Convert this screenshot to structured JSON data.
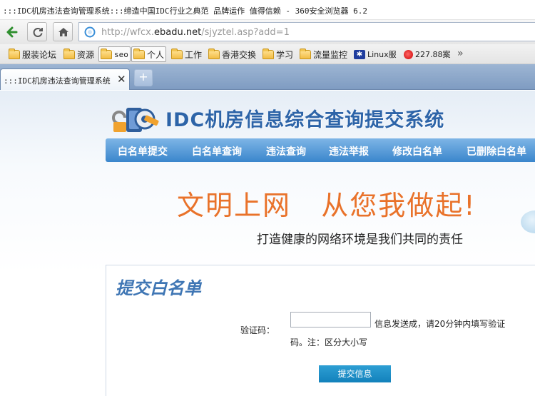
{
  "browser": {
    "window_title": ":::IDC机房违法查询管理系统:::缔造中国IDC行业之典范 品牌运作 值得信赖 - 360安全浏览器 6.2",
    "url_prefix": "http://wfcx.",
    "url_domain": "ebadu.net",
    "url_path": "/sjyztel.asp?add=1",
    "bookmarks": [
      {
        "label": "服装论坛",
        "icon": "folder-icon"
      },
      {
        "label": "资源",
        "icon": "folder-icon"
      },
      {
        "label": "seo",
        "icon": "folder-icon"
      },
      {
        "label": "个人",
        "icon": "folder-icon"
      },
      {
        "label": "工作",
        "icon": "folder-icon"
      },
      {
        "label": "香港交换",
        "icon": "folder-icon"
      },
      {
        "label": "学习",
        "icon": "folder-icon"
      },
      {
        "label": "流量监控",
        "icon": "folder-icon"
      },
      {
        "label": "Linux服",
        "icon": "paw-icon"
      },
      {
        "label": "227.88案",
        "icon": "red-circle-icon"
      }
    ],
    "more_bookmarks": "»",
    "tab": {
      "title": ":::IDC机房违法查询管理系统:",
      "close": "✕"
    },
    "new_tab": "+"
  },
  "site": {
    "title": "IDC机房信息综合查询提交系统",
    "menu": [
      "白名单提交",
      "白名单查询",
      "违法查询",
      "违法举报",
      "修改白名单",
      "已删除白名单"
    ],
    "slogan_1": "文明上网",
    "slogan_2": "从您我做起!",
    "slogan_sub": "打造健康的网络环境是我们共同的责任"
  },
  "form": {
    "title": "提交白名单",
    "captcha_label": "验证码：",
    "captcha_value": "",
    "hint_line1": "信息发送成，请20分钟内填写验证",
    "hint_line2": "码。注：区分大小写",
    "submit_label": "提交信息"
  },
  "colors": {
    "accent": "#3a86cc",
    "title_blue": "#2d64a8",
    "slogan_orange": "#e9722a",
    "button_blue": "#1a8cc6"
  }
}
